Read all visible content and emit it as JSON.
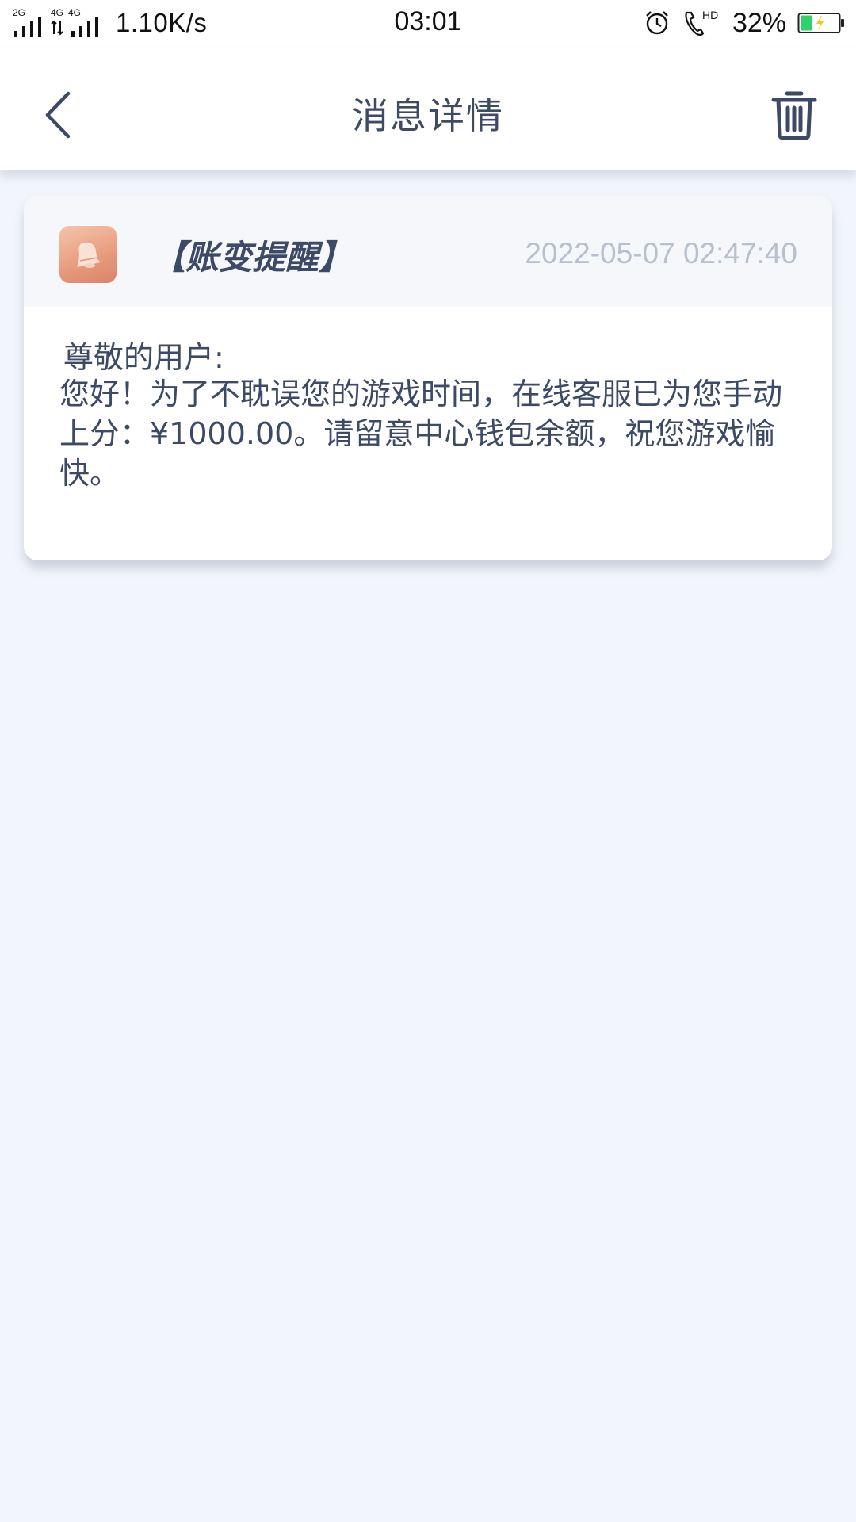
{
  "status_bar": {
    "network_speed": "1.10K/s",
    "time": "03:01",
    "battery_percent": "32%",
    "signal1_label": "2G",
    "signal2_label": "4G",
    "signal3_label": "4G",
    "hd_label": "HD",
    "battery_color": "#2fd16a",
    "charge_color": "#f5c518"
  },
  "header": {
    "title": "消息详情",
    "back_icon": "chevron-left-icon",
    "delete_icon": "trash-icon",
    "icon_color": "#3d4a66"
  },
  "message": {
    "title": "【账变提醒】",
    "timestamp": "2022-05-07 02:47:40",
    "icon": "bell-icon",
    "icon_color": "#e89a7b",
    "greeting": "尊敬的用户:",
    "body": "您好！为了不耽误您的游戏时间，在线客服已为您手动上分：¥1000.00。请留意中心钱包余额，祝您游戏愉快。"
  }
}
